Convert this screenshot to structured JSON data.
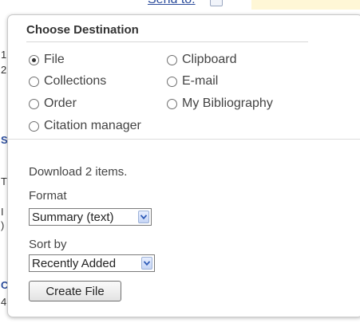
{
  "background": {
    "send_to_label": "Send to:",
    "fragments": [
      "1",
      "2",
      "S",
      "T",
      "I",
      ")",
      "C",
      "4"
    ]
  },
  "popup": {
    "heading": "Choose Destination",
    "destinations": [
      {
        "label": "File",
        "selected": true
      },
      {
        "label": "Clipboard",
        "selected": false
      },
      {
        "label": "Collections",
        "selected": false
      },
      {
        "label": "E-mail",
        "selected": false
      },
      {
        "label": "Order",
        "selected": false
      },
      {
        "label": "My Bibliography",
        "selected": false
      },
      {
        "label": "Citation manager",
        "selected": false
      }
    ],
    "download_text": "Download 2 items.",
    "format_label": "Format",
    "format_value": "Summary (text)",
    "sort_label": "Sort by",
    "sort_value": "Recently Added",
    "create_button": "Create File"
  },
  "colors": {
    "link": "#2a4b9b",
    "dropdown_arrow": "#2f5bb7"
  }
}
